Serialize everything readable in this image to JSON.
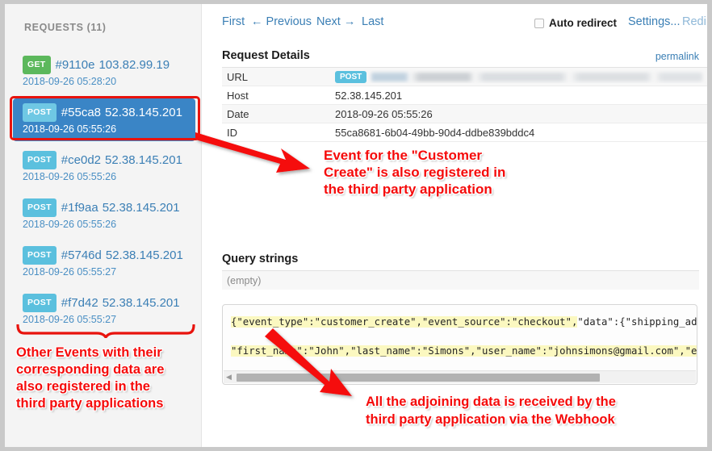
{
  "sidebar": {
    "title": "REQUESTS (11)",
    "items": [
      {
        "verb": "GET",
        "id": "#9110e",
        "ip": "103.82.99.19",
        "time": "2018-09-26 05:28:20",
        "selected": false
      },
      {
        "verb": "POST",
        "id": "#55ca8",
        "ip": "52.38.145.201",
        "time": "2018-09-26 05:55:26",
        "selected": true
      },
      {
        "verb": "POST",
        "id": "#ce0d2",
        "ip": "52.38.145.201",
        "time": "2018-09-26 05:55:26",
        "selected": false
      },
      {
        "verb": "POST",
        "id": "#1f9aa",
        "ip": "52.38.145.201",
        "time": "2018-09-26 05:55:26",
        "selected": false
      },
      {
        "verb": "POST",
        "id": "#5746d",
        "ip": "52.38.145.201",
        "time": "2018-09-26 05:55:27",
        "selected": false
      },
      {
        "verb": "POST",
        "id": "#f7d42",
        "ip": "52.38.145.201",
        "time": "2018-09-26 05:55:27",
        "selected": false
      }
    ]
  },
  "topnav": {
    "first": "First",
    "previous": "← Previous",
    "next": "Next →",
    "last": "Last",
    "auto_redirect_label": "Auto redirect",
    "auto_redirect_checked": false,
    "settings": "Settings...",
    "redirect": "Redi"
  },
  "details": {
    "heading": "Request Details",
    "permalink": "permalink",
    "rows": [
      {
        "key": "URL",
        "value": "",
        "badge": "POST",
        "blurred": true
      },
      {
        "key": "Host",
        "value": "52.38.145.201"
      },
      {
        "key": "Date",
        "value": "2018-09-26 05:55:26"
      },
      {
        "key": "ID",
        "value": "55ca8681-6b04-49bb-90d4-ddbe839bddc4"
      }
    ]
  },
  "query_strings": {
    "heading": "Query strings",
    "empty_text": "(empty)"
  },
  "body": {
    "line1": "{\"event_type\":\"customer_create\",\"event_source\":\"checkout\",\"data\":{\"shipping_addres",
    "line1_highlight": "{\"event_type\":\"customer_create\",\"event_source\":\"checkout\",",
    "line1_rest": "\"data\":{\"shipping_addres",
    "line2": "\"first_name\":\"John\",\"last_name\":\"Simons\",\"user_name\":\"johnsimons@gmail.com\",\"emai"
  },
  "annotations": {
    "top": "Event for the \"Customer\nCreate\" is also registered in\nthe third party application",
    "bottom_left": "Other Events with their\ncorresponding data are\nalso registered in the\nthird party applications",
    "bottom_right": "All the adjoining data is received by the\nthird party application via the Webhook"
  },
  "colors": {
    "accent_blue": "#3b7fb5",
    "selected_bg": "#3a85c6",
    "get_badge": "#5cb85c",
    "post_badge": "#5bc0de",
    "annotation_red": "#f50a0a",
    "highlight_yellow": "#fbf8c0"
  }
}
